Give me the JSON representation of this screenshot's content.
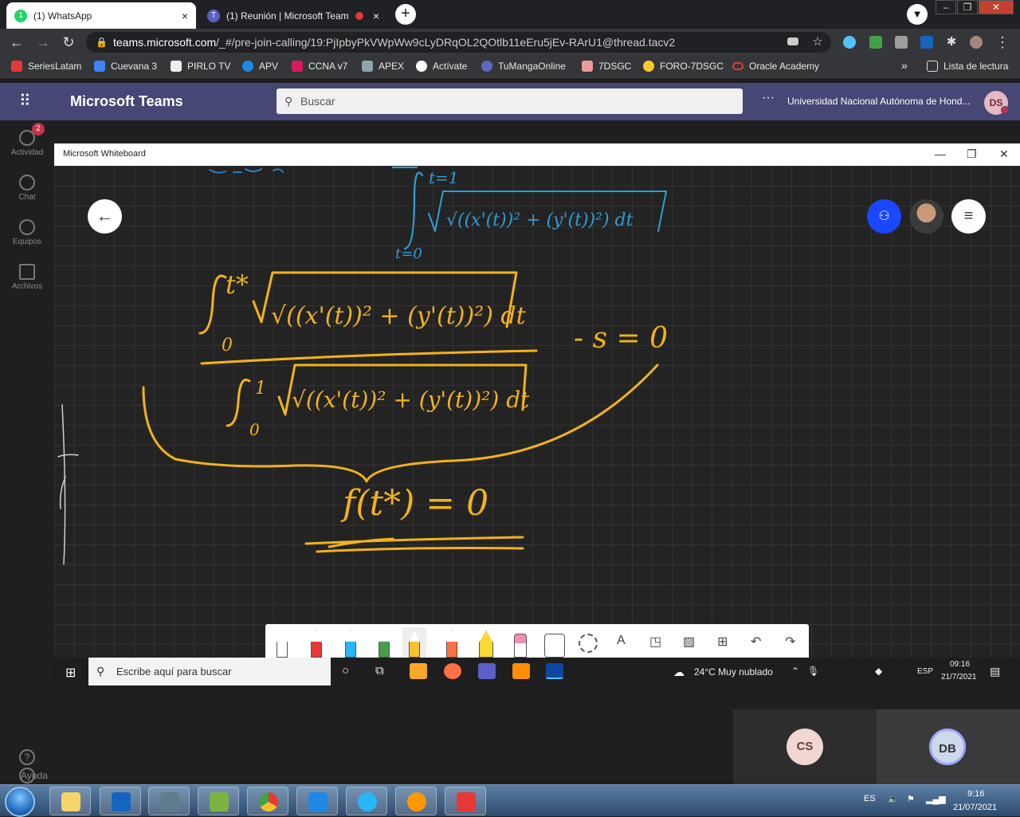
{
  "browser": {
    "tabs": [
      {
        "label": "(1) WhatsApp",
        "close": "×",
        "icon": "whatsapp-icon",
        "color": "#25d366"
      },
      {
        "label": "(1) Reunión | Microsoft Team",
        "close": "×",
        "icon": "teams-icon",
        "color": "#5b5fc7"
      }
    ],
    "new_tab": "+",
    "profile_glyph": "▼",
    "url_host": "teams.microsoft.com",
    "url_path": "/_#/pre-join-calling/19:PjIpbyPkVWpWw9cLyDRqOL2QOtlb11eEru5jEv-RArU1@thread.tacv2",
    "bookmarks": [
      {
        "label": "SeriesLatam",
        "color": "#e53935"
      },
      {
        "label": "Cuevana 3",
        "color": "#3f83f8"
      },
      {
        "label": "PIRLO TV",
        "color": "#eeeeee"
      },
      {
        "label": "APV",
        "color": "#1e88e5"
      },
      {
        "label": "CCNA v7",
        "color": "#d81b60"
      },
      {
        "label": "APEX",
        "color": "#90a4ae"
      },
      {
        "label": "Actívate",
        "color": "#ffffff"
      },
      {
        "label": "TuMangaOnline",
        "color": "#5c6bc0"
      },
      {
        "label": "7DSGC",
        "color": "#ef9a9a"
      },
      {
        "label": "FORO-7DSGC",
        "color": "#ffca28"
      },
      {
        "label": "Oracle Academy",
        "color": "#e53935"
      }
    ],
    "bookmarks_more": "»",
    "reading_list": "Lista de lectura"
  },
  "teams": {
    "title": "Microsoft Teams",
    "search_placeholder": "Buscar",
    "org": "Universidad Nacional Autónoma de Hond...",
    "avatar": "DS",
    "more": "···",
    "rail": [
      {
        "label": "Actividad",
        "badge": "2"
      },
      {
        "label": "Chat"
      },
      {
        "label": "Equipos"
      },
      {
        "label": "Archivos"
      }
    ],
    "help": "Ayuda",
    "help_glyph": "?"
  },
  "whiteboard": {
    "title": "Microsoft Whiteboard",
    "tools_colors": [
      "#ffffff",
      "#e53935",
      "#29b6f6",
      "#43a047",
      "#fbc02d",
      "#ff7043",
      "#fdd835",
      "#f48fb1"
    ],
    "text_tool": "A",
    "handwriting": {
      "top_integral_upper": "t=1",
      "top_integral_body": "√((x'(t))² + (y'(t))²) dt",
      "top_integral_lower": "t=0",
      "numerator_upper": "t*",
      "numerator_lower": "0",
      "numerator_body": "√((x'(t))² + (y'(t))²) dt",
      "rhs": "- s = 0",
      "denominator_upper": "1",
      "denominator_lower": "0",
      "denominator_body": "√((x'(t))² + (y'(t))²) dt",
      "result": "f(t*) = 0"
    }
  },
  "win10_taskbar": {
    "search_placeholder": "Escribe aquí para buscar",
    "weather": "24°C  Muy nublado",
    "lang": "ESP",
    "time": "09:16",
    "date": "21/7/2021"
  },
  "participants": [
    {
      "initials": "CS",
      "color": "#f1d6d1"
    },
    {
      "initials": "DB",
      "color": "#cfd8ea"
    }
  ],
  "win7_taskbar": {
    "lang": "ES",
    "time": "9:16",
    "date": "21/07/2021"
  }
}
